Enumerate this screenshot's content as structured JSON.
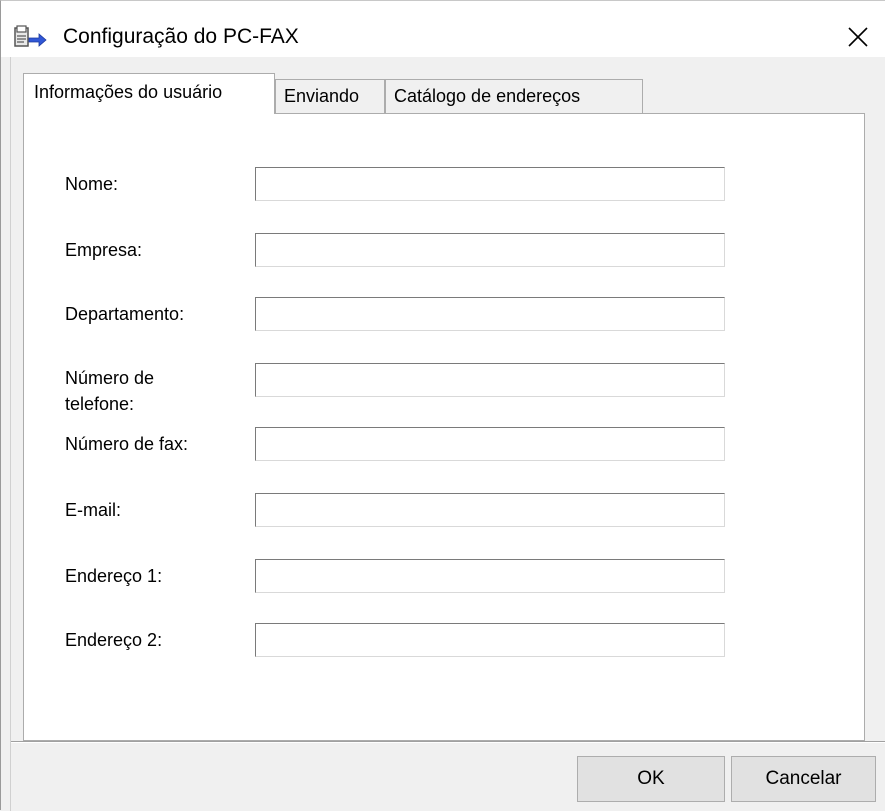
{
  "window": {
    "title": "Configuração do PC-FAX",
    "close_glyph": "✕",
    "icon": "pc-fax-icon"
  },
  "tabs": [
    {
      "label": "Informações do usuário",
      "active": true
    },
    {
      "label": "Enviando",
      "active": false
    },
    {
      "label": "Catálogo de endereços",
      "active": false
    }
  ],
  "fields": [
    {
      "label": "Nome:",
      "value": ""
    },
    {
      "label": "Empresa:",
      "value": ""
    },
    {
      "label": "Departamento:",
      "value": ""
    },
    {
      "label": "Número de telefone:",
      "label_line1": "Número de",
      "label_line2": "telefone:",
      "value": ""
    },
    {
      "label": "Número de fax:",
      "value": ""
    },
    {
      "label": "E-mail:",
      "value": ""
    },
    {
      "label": "Endereço 1:",
      "value": ""
    },
    {
      "label": "Endereço 2:",
      "value": ""
    }
  ],
  "buttons": {
    "ok": "OK",
    "cancel": "Cancelar"
  }
}
